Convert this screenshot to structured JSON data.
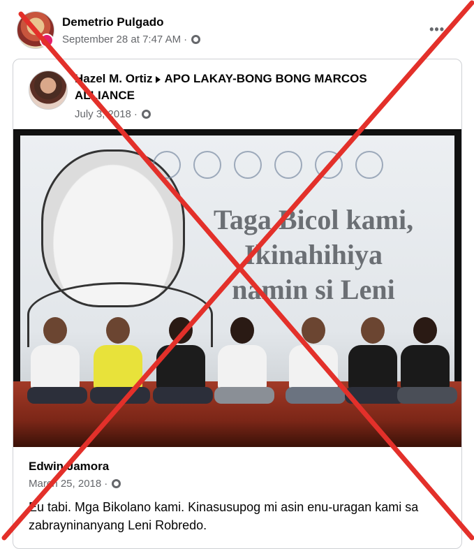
{
  "post": {
    "author": "Demetrio Pulgado",
    "timestamp": "September 28 at 7:47 AM",
    "privacy_icon": "globe-icon",
    "more_label": "•••"
  },
  "shared": {
    "author": "Hazel M. Ortiz",
    "group": "APO LAKAY-BONG BONG MARCOS ALLIANCE",
    "timestamp": "July 3, 2018",
    "privacy_icon": "globe-icon"
  },
  "image": {
    "slogan_line1": "Taga Bicol kami,",
    "slogan_line2": "Ikinahihiya",
    "slogan_line3": "namin si Leni"
  },
  "comment": {
    "author": "Edwin Jamora",
    "timestamp": "March 25, 2018",
    "text": "Eu tabi. Mga Bikolano kami. Kinasusupog mi  asin enu-uragan kami sa zabrayninanyang Leni Robredo."
  },
  "overlay": {
    "mark": "red-x",
    "color": "#e3302a"
  }
}
